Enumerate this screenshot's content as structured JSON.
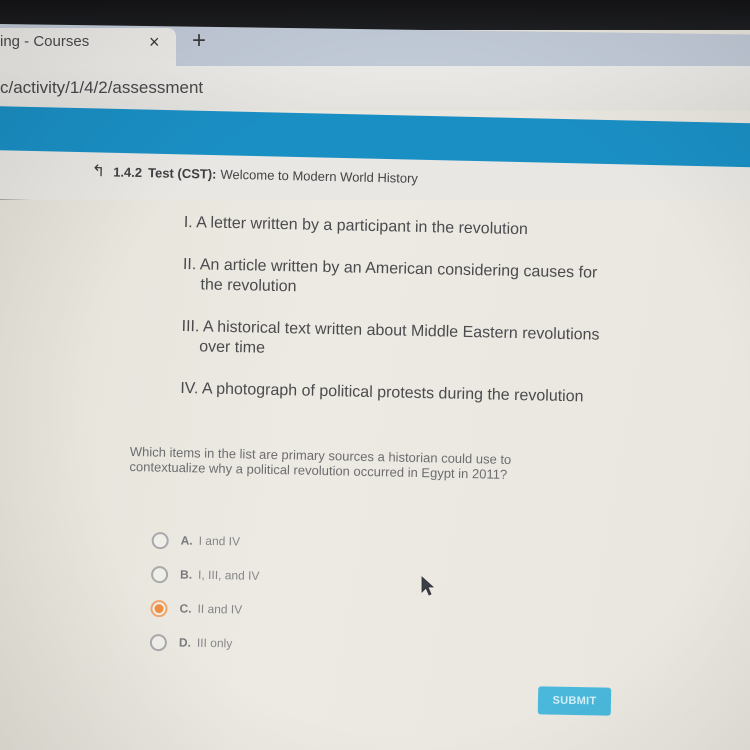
{
  "browser": {
    "tab_title": "ing - Courses",
    "tab_close_icon": "×",
    "new_tab_icon": "+",
    "address": "c/activity/1/4/2/assessment"
  },
  "colors": {
    "header_blue": "#1a8fc4",
    "selected_orange": "#ef8f45",
    "submit_blue": "#4ab8db"
  },
  "breadcrumb": {
    "up_icon": "↰",
    "number": "1.4.2",
    "type": "Test (CST):",
    "title": "Welcome to Modern World History"
  },
  "list": [
    {
      "numeral": "I.",
      "text": "A letter written by a participant in the revolution"
    },
    {
      "numeral": "II.",
      "text": "An article written by an American considering causes for the revolution"
    },
    {
      "numeral": "III.",
      "text": "A historical text written about Middle Eastern revolutions over time"
    },
    {
      "numeral": "IV.",
      "text": "A photograph of political protests during the revolution"
    }
  ],
  "question": "Which items in the list are primary sources a historian could use to contextualize why a political revolution occurred in Egypt in 2011?",
  "options": [
    {
      "letter": "A.",
      "text": "I and IV",
      "selected": false
    },
    {
      "letter": "B.",
      "text": "I, III, and IV",
      "selected": false
    },
    {
      "letter": "C.",
      "text": "II and IV",
      "selected": true
    },
    {
      "letter": "D.",
      "text": "III only",
      "selected": false
    }
  ],
  "submit_label": "SUBMIT"
}
